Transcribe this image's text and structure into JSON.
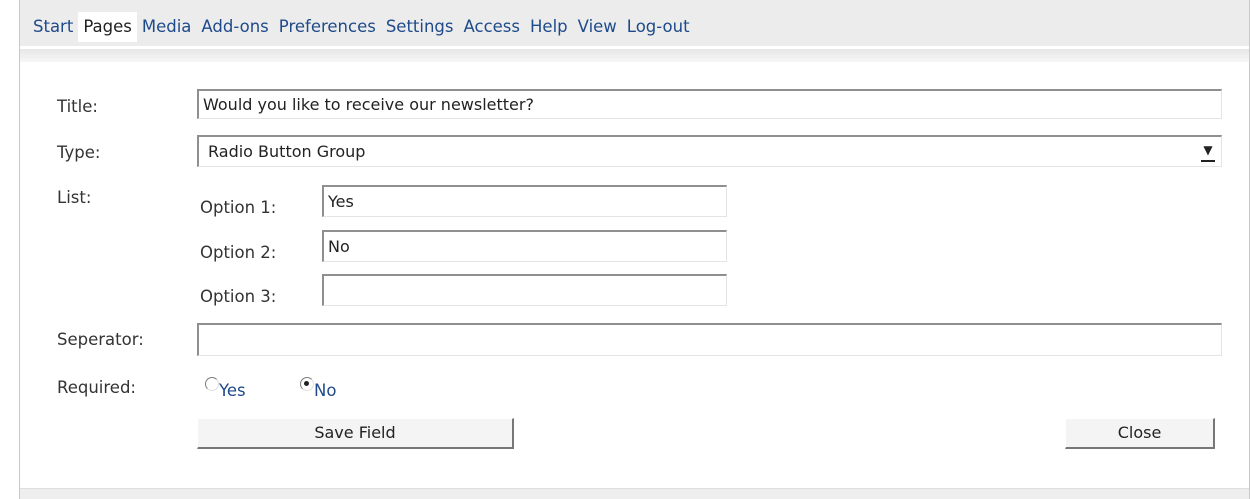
{
  "nav": {
    "tabs": [
      {
        "label": "Start"
      },
      {
        "label": "Pages"
      },
      {
        "label": "Media"
      },
      {
        "label": "Add-ons"
      },
      {
        "label": "Preferences"
      },
      {
        "label": "Settings"
      },
      {
        "label": "Access"
      },
      {
        "label": "Help"
      },
      {
        "label": "View"
      },
      {
        "label": "Log-out"
      }
    ],
    "active": "Pages"
  },
  "form": {
    "title_label": "Title:",
    "title_value": "Would you like to receive our newsletter?",
    "type_label": "Type:",
    "type_value": "Radio Button Group",
    "list_label": "List:",
    "options": [
      {
        "label": "Option 1:",
        "value": "Yes"
      },
      {
        "label": "Option 2:",
        "value": "No"
      },
      {
        "label": "Option 3:",
        "value": ""
      }
    ],
    "separator_label": "Seperator:",
    "separator_value": "",
    "required_label": "Required:",
    "required_yes": "Yes",
    "required_no": "No",
    "required_selected": "No"
  },
  "buttons": {
    "save": "Save Field",
    "close": "Close"
  },
  "colors": {
    "link": "#1e4a8a",
    "top_strip": "#ececec"
  }
}
